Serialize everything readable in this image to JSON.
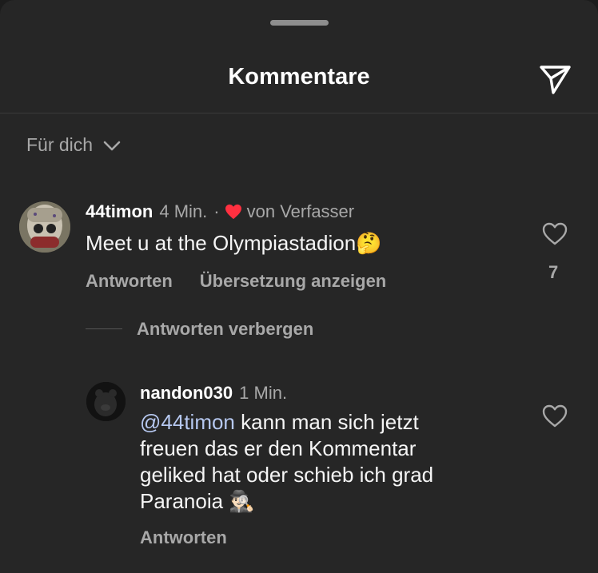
{
  "header": {
    "title": "Kommentare"
  },
  "filter": {
    "label": "Für dich"
  },
  "comments": [
    {
      "username": "44timon",
      "time": "4 Min.",
      "separator": "·",
      "author_liked": "von Verfasser",
      "text": "Meet u at the Olympiastadion🤔",
      "reply_label": "Antworten",
      "translate_label": "Übersetzung anzeigen",
      "like_count": "7",
      "hide_replies_label": "Antworten verbergen"
    },
    {
      "username": "nandon030",
      "time": "1 Min.",
      "mention": "@44timon",
      "text_line1": " kann man sich jetzt",
      "text_line2": "freuen das er den Kommentar",
      "text_line3": "geliked hat oder schieb ich grad",
      "text_line4": "Paranoia 🕵🏻‍♂️",
      "reply_label": "Antworten"
    }
  ],
  "colors": {
    "background": "#262626",
    "heart_red": "#ff3040",
    "mention": "#b6c8f0",
    "secondary_text": "#a8a8a8"
  }
}
